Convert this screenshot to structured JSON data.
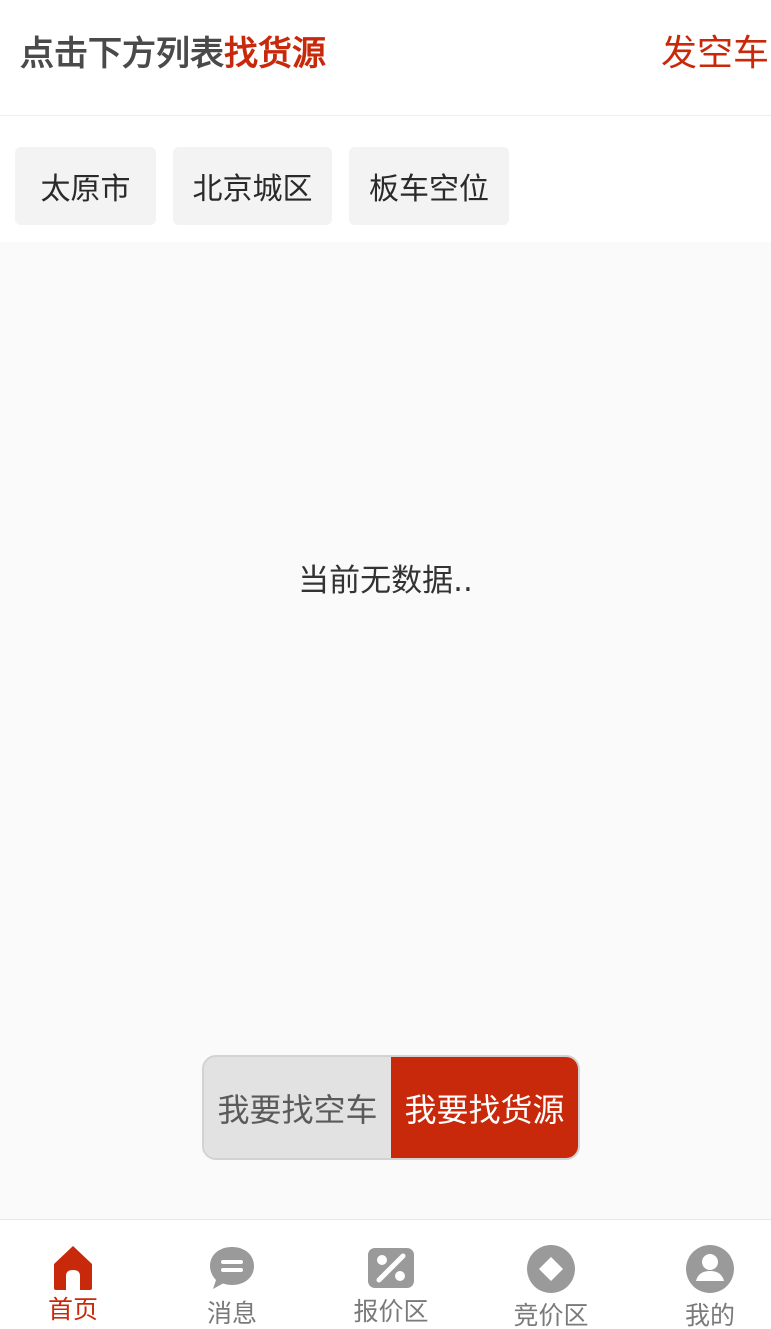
{
  "header": {
    "title_prefix": "点击下方列表",
    "title_accent": "找货源",
    "action_label": "发空车"
  },
  "filters": [
    "太原市",
    "北京城区",
    "板车空位"
  ],
  "empty_text": "当前无数据..",
  "toggle": {
    "left_label": "我要找空车",
    "right_label": "我要找货源",
    "selected": "我要找货源"
  },
  "tabbar": {
    "items": [
      {
        "label": "首页",
        "icon": "home-icon",
        "active": true
      },
      {
        "label": "消息",
        "icon": "message-icon",
        "active": false
      },
      {
        "label": "报价区",
        "icon": "percent-icon",
        "active": false
      },
      {
        "label": "竞价区",
        "icon": "diamond-icon",
        "active": false
      },
      {
        "label": "我的",
        "icon": "user-icon",
        "active": false
      }
    ]
  },
  "colors": {
    "accent": "#c8290a",
    "inactive_tab": "#7a7a7a",
    "background": "#fafafa"
  }
}
